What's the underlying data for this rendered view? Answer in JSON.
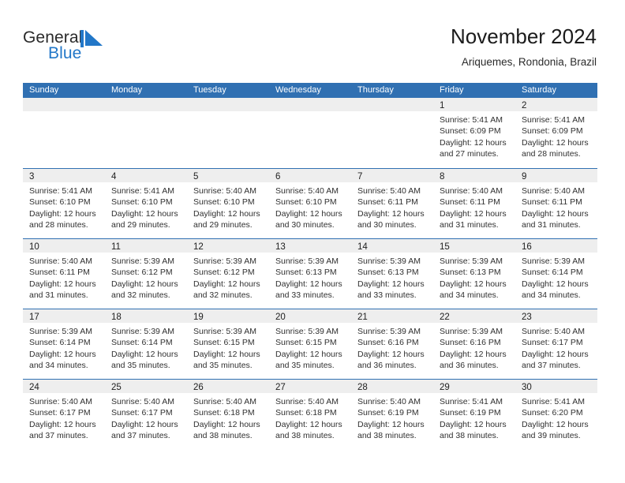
{
  "brand": {
    "word_one": "General",
    "word_two": "Blue",
    "mark": "triangle-logo",
    "color_text": "#2a2a2a",
    "color_blue": "#2277c8"
  },
  "header": {
    "title": "November 2024",
    "subtitle": "Ariquemes, Rondonia, Brazil",
    "accent_color": "#3070b2",
    "band_color": "#eeeeee"
  },
  "calendar": {
    "weekdays": [
      "Sunday",
      "Monday",
      "Tuesday",
      "Wednesday",
      "Thursday",
      "Friday",
      "Saturday"
    ],
    "weeks": [
      [
        {
          "day": "",
          "lines": []
        },
        {
          "day": "",
          "lines": []
        },
        {
          "day": "",
          "lines": []
        },
        {
          "day": "",
          "lines": []
        },
        {
          "day": "",
          "lines": []
        },
        {
          "day": "1",
          "lines": [
            "Sunrise: 5:41 AM",
            "Sunset: 6:09 PM",
            "Daylight: 12 hours",
            "and 27 minutes."
          ]
        },
        {
          "day": "2",
          "lines": [
            "Sunrise: 5:41 AM",
            "Sunset: 6:09 PM",
            "Daylight: 12 hours",
            "and 28 minutes."
          ]
        }
      ],
      [
        {
          "day": "3",
          "lines": [
            "Sunrise: 5:41 AM",
            "Sunset: 6:10 PM",
            "Daylight: 12 hours",
            "and 28 minutes."
          ]
        },
        {
          "day": "4",
          "lines": [
            "Sunrise: 5:41 AM",
            "Sunset: 6:10 PM",
            "Daylight: 12 hours",
            "and 29 minutes."
          ]
        },
        {
          "day": "5",
          "lines": [
            "Sunrise: 5:40 AM",
            "Sunset: 6:10 PM",
            "Daylight: 12 hours",
            "and 29 minutes."
          ]
        },
        {
          "day": "6",
          "lines": [
            "Sunrise: 5:40 AM",
            "Sunset: 6:10 PM",
            "Daylight: 12 hours",
            "and 30 minutes."
          ]
        },
        {
          "day": "7",
          "lines": [
            "Sunrise: 5:40 AM",
            "Sunset: 6:11 PM",
            "Daylight: 12 hours",
            "and 30 minutes."
          ]
        },
        {
          "day": "8",
          "lines": [
            "Sunrise: 5:40 AM",
            "Sunset: 6:11 PM",
            "Daylight: 12 hours",
            "and 31 minutes."
          ]
        },
        {
          "day": "9",
          "lines": [
            "Sunrise: 5:40 AM",
            "Sunset: 6:11 PM",
            "Daylight: 12 hours",
            "and 31 minutes."
          ]
        }
      ],
      [
        {
          "day": "10",
          "lines": [
            "Sunrise: 5:40 AM",
            "Sunset: 6:11 PM",
            "Daylight: 12 hours",
            "and 31 minutes."
          ]
        },
        {
          "day": "11",
          "lines": [
            "Sunrise: 5:39 AM",
            "Sunset: 6:12 PM",
            "Daylight: 12 hours",
            "and 32 minutes."
          ]
        },
        {
          "day": "12",
          "lines": [
            "Sunrise: 5:39 AM",
            "Sunset: 6:12 PM",
            "Daylight: 12 hours",
            "and 32 minutes."
          ]
        },
        {
          "day": "13",
          "lines": [
            "Sunrise: 5:39 AM",
            "Sunset: 6:13 PM",
            "Daylight: 12 hours",
            "and 33 minutes."
          ]
        },
        {
          "day": "14",
          "lines": [
            "Sunrise: 5:39 AM",
            "Sunset: 6:13 PM",
            "Daylight: 12 hours",
            "and 33 minutes."
          ]
        },
        {
          "day": "15",
          "lines": [
            "Sunrise: 5:39 AM",
            "Sunset: 6:13 PM",
            "Daylight: 12 hours",
            "and 34 minutes."
          ]
        },
        {
          "day": "16",
          "lines": [
            "Sunrise: 5:39 AM",
            "Sunset: 6:14 PM",
            "Daylight: 12 hours",
            "and 34 minutes."
          ]
        }
      ],
      [
        {
          "day": "17",
          "lines": [
            "Sunrise: 5:39 AM",
            "Sunset: 6:14 PM",
            "Daylight: 12 hours",
            "and 34 minutes."
          ]
        },
        {
          "day": "18",
          "lines": [
            "Sunrise: 5:39 AM",
            "Sunset: 6:14 PM",
            "Daylight: 12 hours",
            "and 35 minutes."
          ]
        },
        {
          "day": "19",
          "lines": [
            "Sunrise: 5:39 AM",
            "Sunset: 6:15 PM",
            "Daylight: 12 hours",
            "and 35 minutes."
          ]
        },
        {
          "day": "20",
          "lines": [
            "Sunrise: 5:39 AM",
            "Sunset: 6:15 PM",
            "Daylight: 12 hours",
            "and 35 minutes."
          ]
        },
        {
          "day": "21",
          "lines": [
            "Sunrise: 5:39 AM",
            "Sunset: 6:16 PM",
            "Daylight: 12 hours",
            "and 36 minutes."
          ]
        },
        {
          "day": "22",
          "lines": [
            "Sunrise: 5:39 AM",
            "Sunset: 6:16 PM",
            "Daylight: 12 hours",
            "and 36 minutes."
          ]
        },
        {
          "day": "23",
          "lines": [
            "Sunrise: 5:40 AM",
            "Sunset: 6:17 PM",
            "Daylight: 12 hours",
            "and 37 minutes."
          ]
        }
      ],
      [
        {
          "day": "24",
          "lines": [
            "Sunrise: 5:40 AM",
            "Sunset: 6:17 PM",
            "Daylight: 12 hours",
            "and 37 minutes."
          ]
        },
        {
          "day": "25",
          "lines": [
            "Sunrise: 5:40 AM",
            "Sunset: 6:17 PM",
            "Daylight: 12 hours",
            "and 37 minutes."
          ]
        },
        {
          "day": "26",
          "lines": [
            "Sunrise: 5:40 AM",
            "Sunset: 6:18 PM",
            "Daylight: 12 hours",
            "and 38 minutes."
          ]
        },
        {
          "day": "27",
          "lines": [
            "Sunrise: 5:40 AM",
            "Sunset: 6:18 PM",
            "Daylight: 12 hours",
            "and 38 minutes."
          ]
        },
        {
          "day": "28",
          "lines": [
            "Sunrise: 5:40 AM",
            "Sunset: 6:19 PM",
            "Daylight: 12 hours",
            "and 38 minutes."
          ]
        },
        {
          "day": "29",
          "lines": [
            "Sunrise: 5:41 AM",
            "Sunset: 6:19 PM",
            "Daylight: 12 hours",
            "and 38 minutes."
          ]
        },
        {
          "day": "30",
          "lines": [
            "Sunrise: 5:41 AM",
            "Sunset: 6:20 PM",
            "Daylight: 12 hours",
            "and 39 minutes."
          ]
        }
      ]
    ]
  }
}
